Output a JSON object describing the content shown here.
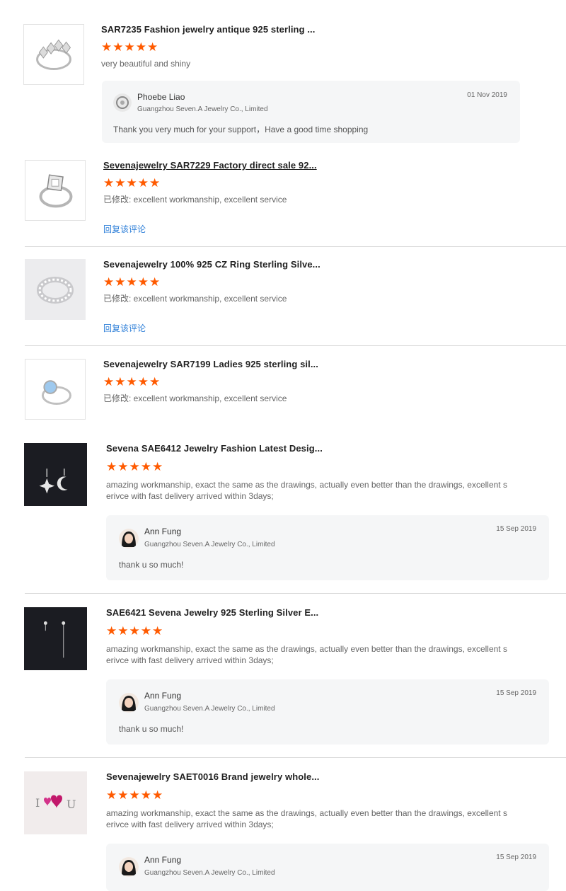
{
  "reviews": [
    {
      "title": "SAR7235 Fashion jewelry antique 925 sterling ...",
      "stars": "★★★★★",
      "text": "very beautiful and shiny",
      "reply": {
        "name": "Phoebe Liao",
        "company": "Guangzhou Seven.A Jewelry Co., Limited",
        "date": "01 Nov 2019",
        "message": "Thank you very much for your support，Have a good time shopping"
      }
    },
    {
      "title": "Sevenajewelry SAR7229 Factory direct sale 92...",
      "stars": "★★★★★",
      "text": "已修改: excellent workmanship, excellent service",
      "link": "回复该评论"
    },
    {
      "title": "Sevenajewelry 100% 925 CZ Ring Sterling Silve...",
      "stars": "★★★★★",
      "text": "已修改: excellent workmanship, excellent service",
      "link": "回复该评论"
    },
    {
      "title": "Sevenajewelry SAR7199 Ladies 925 sterling sil...",
      "stars": "★★★★★",
      "text": "已修改: excellent workmanship, excellent service"
    },
    {
      "title": "Sevena SAE6412 Jewelry Fashion Latest Desig...",
      "stars": "★★★★★",
      "text_line1": "amazing workmanship, exact the same as the drawings, actually even better than the drawings, excellent s",
      "text_line2": "erivce with fast delivery arrived within 3days;",
      "reply": {
        "name": "Ann Fung",
        "company": "Guangzhou Seven.A Jewelry Co., Limited",
        "date": "15 Sep 2019",
        "message": "thank u so much!"
      }
    },
    {
      "title": "SAE6421 Sevena Jewelry 925 Sterling Silver E...",
      "stars": "★★★★★",
      "text_line1": "amazing workmanship, exact the same as the drawings, actually even better than the drawings, excellent s",
      "text_line2": "erivce with fast delivery arrived within 3days;",
      "reply": {
        "name": "Ann Fung",
        "company": "Guangzhou Seven.A Jewelry Co., Limited",
        "date": "15 Sep 2019",
        "message": "thank u so much!"
      }
    },
    {
      "title": "Sevenajewelry SAET0016 Brand jewelry whole...",
      "stars": "★★★★★",
      "text_line1": "amazing workmanship, exact the same as the drawings, actually even better than the drawings, excellent s",
      "text_line2": "erivce with fast delivery arrived within 3days;",
      "reply": {
        "name": "Ann Fung",
        "company": "Guangzhou Seven.A Jewelry Co., Limited",
        "date": "15 Sep 2019"
      }
    }
  ],
  "colors": {
    "star": "#ff5a00",
    "link": "#2e7fd8",
    "reply_bg": "#f5f6f7"
  },
  "icons": [
    "ring-thumbnail",
    "earring-thumbnail",
    "avatar"
  ]
}
